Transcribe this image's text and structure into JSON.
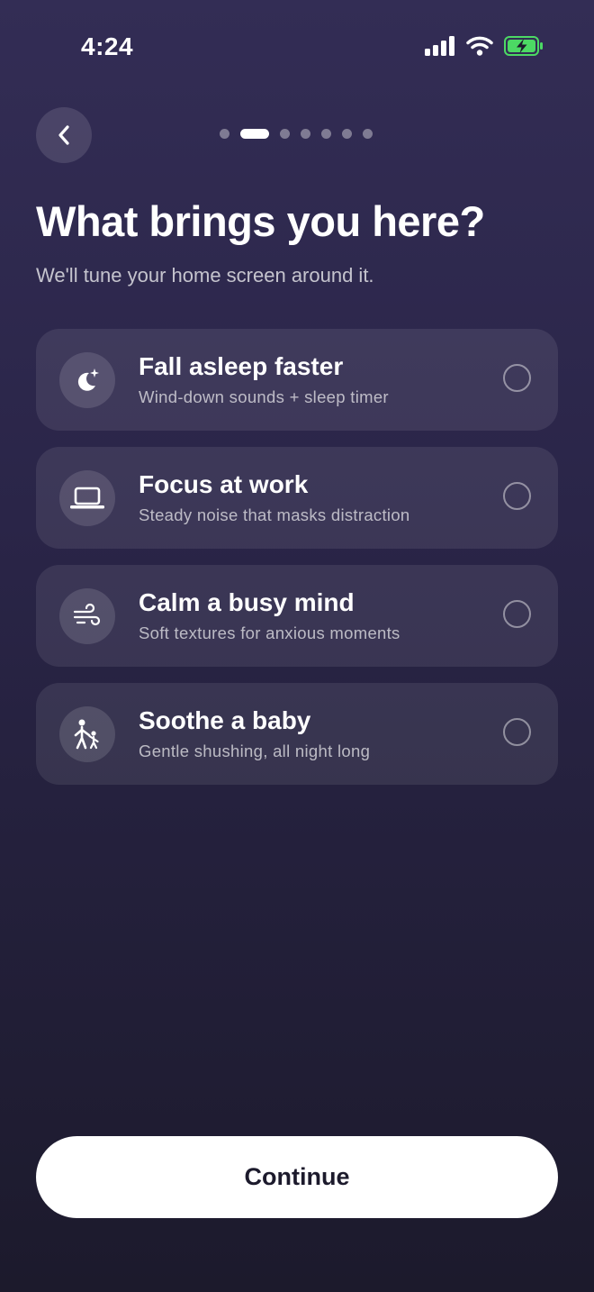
{
  "status_bar": {
    "time": "4:24",
    "icons": [
      "cellular-signal-icon",
      "wifi-icon",
      "battery-charging-icon"
    ],
    "battery_color": "#4cd964"
  },
  "header": {
    "back_icon": "chevron-left-icon",
    "pager": {
      "total_steps": 7,
      "current_step": 2
    }
  },
  "content": {
    "title": "What brings you here?",
    "subtitle": "We'll tune your home screen around it.",
    "options": [
      {
        "icon": "moon-stars-icon",
        "title": "Fall asleep faster",
        "description": "Wind-down sounds + sleep timer",
        "selected": false
      },
      {
        "icon": "laptop-icon",
        "title": "Focus at work",
        "description": "Steady noise that masks distraction",
        "selected": false
      },
      {
        "icon": "wind-icon",
        "title": "Calm a busy mind",
        "description": "Soft textures for anxious moments",
        "selected": false
      },
      {
        "icon": "parent-child-icon",
        "title": "Soothe a baby",
        "description": "Gentle shushing, all night long",
        "selected": false
      }
    ]
  },
  "footer": {
    "continue_label": "Continue"
  },
  "colors": {
    "background_top": "#332d55",
    "background_bottom": "#1c1a2c",
    "button_background": "#ffffff",
    "button_text": "#1c1a2c"
  }
}
